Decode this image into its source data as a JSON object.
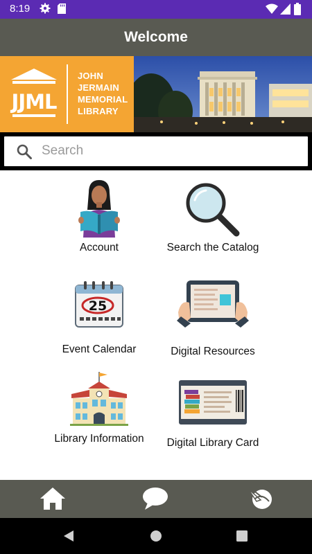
{
  "status_bar": {
    "time": "8:19",
    "icons": [
      "gear-icon",
      "sd-card-icon",
      "wifi-icon",
      "signal-icon",
      "battery-icon"
    ]
  },
  "app_bar": {
    "title": "Welcome"
  },
  "banner": {
    "logo_monogram": "JJML",
    "logo_lines": [
      "JOHN",
      "JERMAIN",
      "MEMORIAL",
      "LIBRARY"
    ],
    "brand_color": "#f4a533"
  },
  "search": {
    "placeholder": "Search",
    "value": ""
  },
  "tiles": [
    {
      "label": "Account",
      "icon": "reader-account-icon"
    },
    {
      "label": "Search the Catalog",
      "icon": "magnifier-icon"
    },
    {
      "label": "Event Calendar",
      "icon": "calendar-icon",
      "icon_text": "25"
    },
    {
      "label": "Digital Resources",
      "icon": "tablet-icon"
    },
    {
      "label": "Library Information",
      "icon": "library-building-icon"
    },
    {
      "label": "Digital Library Card",
      "icon": "library-card-icon"
    }
  ],
  "bottom_nav": {
    "items": [
      "home-icon",
      "chat-icon",
      "location-icon"
    ]
  },
  "system_nav": {
    "items": [
      "back-icon",
      "home-circle-icon",
      "recents-icon"
    ]
  },
  "colors": {
    "status_bar": "#5b2bb3",
    "app_bar": "#595a52",
    "accent": "#f4a533"
  }
}
